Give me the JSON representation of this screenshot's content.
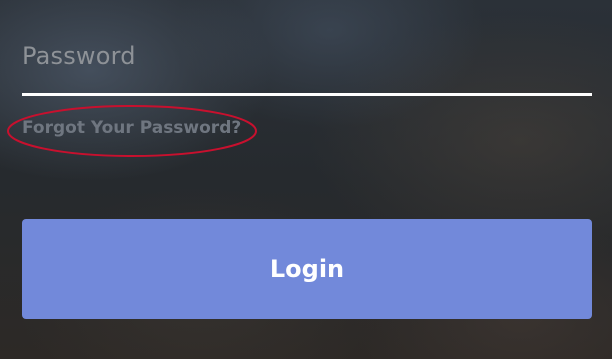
{
  "login_form": {
    "password_field": {
      "placeholder": "Password",
      "value": ""
    },
    "forgot_link": "Forgot Your Password?",
    "login_button": "Login"
  },
  "annotation": {
    "color": "#c8102e",
    "shape": "ellipse",
    "target": "forgot-password-link"
  },
  "colors": {
    "accent": "#7289da",
    "underline": "#ffffff",
    "placeholder_text": "#8e9297",
    "link_text": "#6f7680"
  }
}
